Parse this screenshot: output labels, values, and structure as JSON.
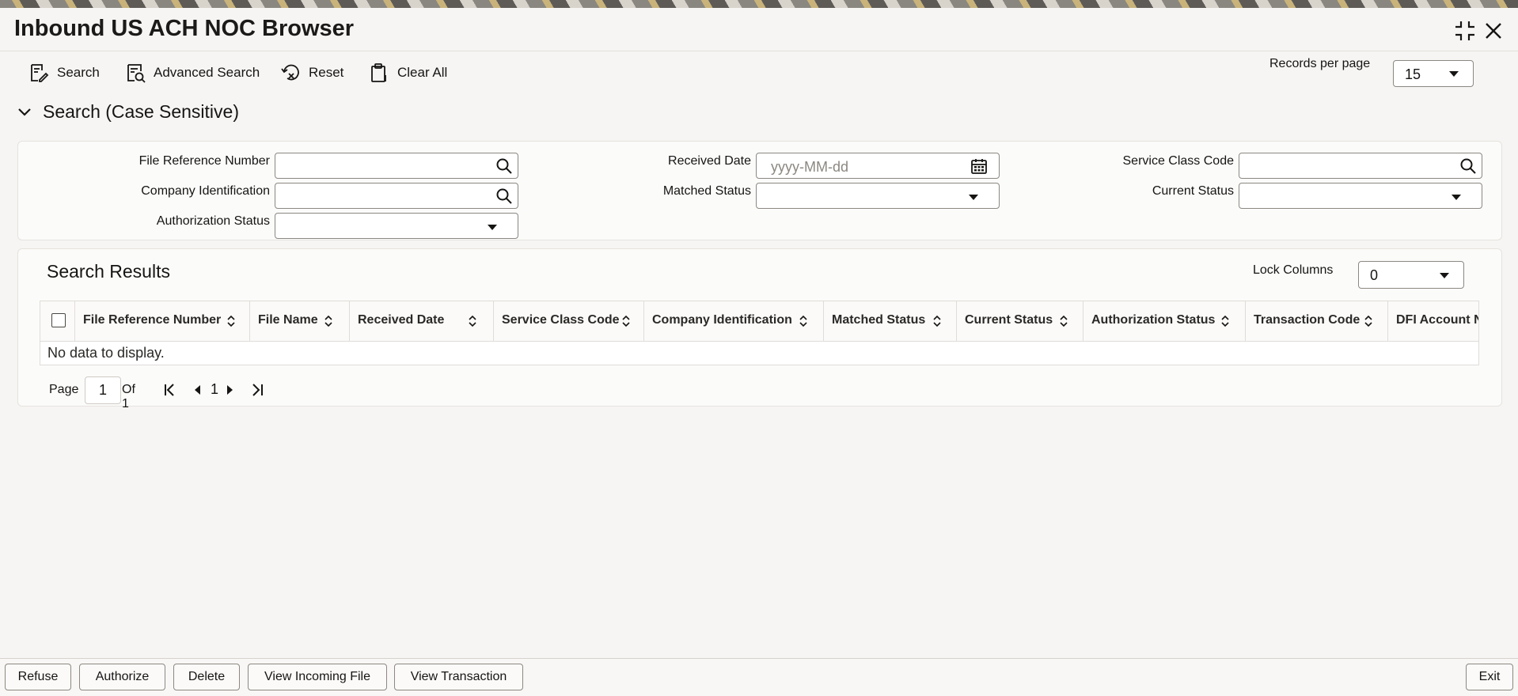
{
  "app": {
    "title": "Inbound US ACH NOC Browser"
  },
  "toolbar": {
    "search": "Search",
    "advanced_search": "Advanced Search",
    "reset": "Reset",
    "clear_all": "Clear All",
    "records_per_page_label": "Records per page",
    "records_per_page_value": "15"
  },
  "search_section": {
    "title": "Search (Case Sensitive)",
    "fields": {
      "file_reference_number": "File Reference Number",
      "company_identification": "Company Identification",
      "authorization_status": "Authorization Status",
      "received_date": "Received Date",
      "received_date_placeholder": "yyyy-MM-dd",
      "matched_status": "Matched Status",
      "service_class_code": "Service Class Code",
      "current_status": "Current Status"
    }
  },
  "results": {
    "title": "Search Results",
    "lock_columns_label": "Lock Columns",
    "lock_columns_value": "0",
    "columns": [
      "File Reference Number",
      "File Name",
      "Received Date",
      "Service Class Code",
      "Company Identification",
      "Matched Status",
      "Current Status",
      "Authorization Status",
      "Transaction Code",
      "DFI Account N"
    ],
    "empty_message": "No data to display."
  },
  "pagination": {
    "page_label": "Page",
    "current_page": "1",
    "of_label": "Of 1",
    "page_number": "1"
  },
  "footer": {
    "refuse": "Refuse",
    "authorize": "Authorize",
    "delete": "Delete",
    "view_incoming_file": "View Incoming File",
    "view_transaction": "View Transaction",
    "exit": "Exit"
  }
}
